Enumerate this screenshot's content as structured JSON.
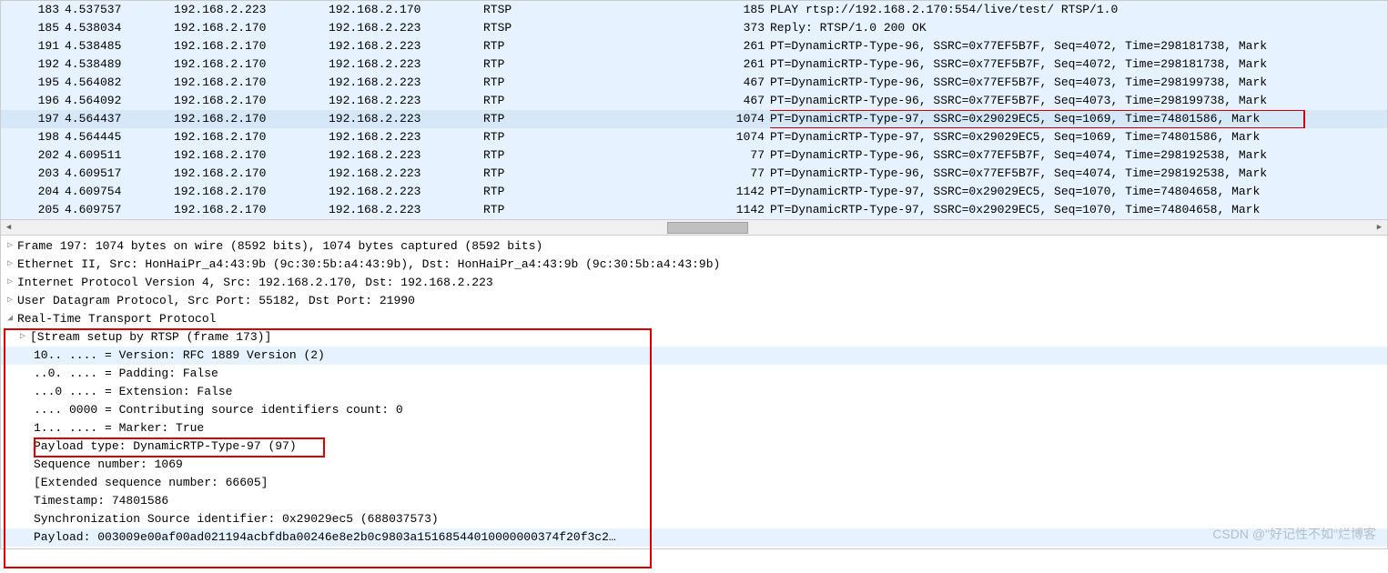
{
  "packets": [
    {
      "no": "183",
      "time": "4.537537",
      "src": "192.168.2.223",
      "dst": "192.168.2.170",
      "proto": "RTSP",
      "len": "185",
      "info": "PLAY rtsp://192.168.2.170:554/live/test/ RTSP/1.0",
      "hl": true
    },
    {
      "no": "185",
      "time": "4.538034",
      "src": "192.168.2.170",
      "dst": "192.168.2.223",
      "proto": "RTSP",
      "len": "373",
      "info": "Reply: RTSP/1.0 200 OK",
      "hl": true
    },
    {
      "no": "191",
      "time": "4.538485",
      "src": "192.168.2.170",
      "dst": "192.168.2.223",
      "proto": "RTP",
      "len": "261",
      "info": "PT=DynamicRTP-Type-96, SSRC=0x77EF5B7F, Seq=4072, Time=298181738, Mark",
      "hl": true
    },
    {
      "no": "192",
      "time": "4.538489",
      "src": "192.168.2.170",
      "dst": "192.168.2.223",
      "proto": "RTP",
      "len": "261",
      "info": "PT=DynamicRTP-Type-96, SSRC=0x77EF5B7F, Seq=4072, Time=298181738, Mark",
      "hl": true
    },
    {
      "no": "195",
      "time": "4.564082",
      "src": "192.168.2.170",
      "dst": "192.168.2.223",
      "proto": "RTP",
      "len": "467",
      "info": "PT=DynamicRTP-Type-96, SSRC=0x77EF5B7F, Seq=4073, Time=298199738, Mark",
      "hl": true
    },
    {
      "no": "196",
      "time": "4.564092",
      "src": "192.168.2.170",
      "dst": "192.168.2.223",
      "proto": "RTP",
      "len": "467",
      "info": "PT=DynamicRTP-Type-96, SSRC=0x77EF5B7F, Seq=4073, Time=298199738, Mark",
      "hl": true
    },
    {
      "no": "197",
      "time": "4.564437",
      "src": "192.168.2.170",
      "dst": "192.168.2.223",
      "proto": "RTP",
      "len": "1074",
      "info": "PT=DynamicRTP-Type-97, SSRC=0x29029EC5, Seq=1069, Time=74801586, Mark",
      "sel": true,
      "rb": true
    },
    {
      "no": "198",
      "time": "4.564445",
      "src": "192.168.2.170",
      "dst": "192.168.2.223",
      "proto": "RTP",
      "len": "1074",
      "info": "PT=DynamicRTP-Type-97, SSRC=0x29029EC5, Seq=1069, Time=74801586, Mark",
      "hl": true
    },
    {
      "no": "202",
      "time": "4.609511",
      "src": "192.168.2.170",
      "dst": "192.168.2.223",
      "proto": "RTP",
      "len": "77",
      "info": "PT=DynamicRTP-Type-96, SSRC=0x77EF5B7F, Seq=4074, Time=298192538, Mark",
      "hl": true
    },
    {
      "no": "203",
      "time": "4.609517",
      "src": "192.168.2.170",
      "dst": "192.168.2.223",
      "proto": "RTP",
      "len": "77",
      "info": "PT=DynamicRTP-Type-96, SSRC=0x77EF5B7F, Seq=4074, Time=298192538, Mark",
      "hl": true
    },
    {
      "no": "204",
      "time": "4.609754",
      "src": "192.168.2.170",
      "dst": "192.168.2.223",
      "proto": "RTP",
      "len": "1142",
      "info": "PT=DynamicRTP-Type-97, SSRC=0x29029EC5, Seq=1070, Time=74804658, Mark",
      "hl": true
    },
    {
      "no": "205",
      "time": "4.609757",
      "src": "192.168.2.170",
      "dst": "192.168.2.223",
      "proto": "RTP",
      "len": "1142",
      "info": "PT=DynamicRTP-Type-97, SSRC=0x29029EC5, Seq=1070, Time=74804658, Mark",
      "hl": true
    }
  ],
  "details": {
    "frame": "Frame 197: 1074 bytes on wire (8592 bits), 1074 bytes captured (8592 bits)",
    "eth": "Ethernet II, Src: HonHaiPr_a4:43:9b (9c:30:5b:a4:43:9b), Dst: HonHaiPr_a4:43:9b (9c:30:5b:a4:43:9b)",
    "ip": "Internet Protocol Version 4, Src: 192.168.2.170, Dst: 192.168.2.223",
    "udp": "User Datagram Protocol, Src Port: 55182, Dst Port: 21990",
    "rtp": "Real-Time Transport Protocol",
    "setup": "[Stream setup by RTSP (frame 173)]",
    "version": "10.. .... = Version: RFC 1889 Version (2)",
    "padding": "..0. .... = Padding: False",
    "ext": "...0 .... = Extension: False",
    "csrc": ".... 0000 = Contributing source identifiers count: 0",
    "marker": "1... .... = Marker: True",
    "pt": "Payload type: DynamicRTP-Type-97 (97)",
    "seq": "Sequence number: 1069",
    "extseq": "[Extended sequence number: 66605]",
    "ts": "Timestamp: 74801586",
    "ssrc": "Synchronization Source identifier: 0x29029ec5 (688037573)",
    "payload": "Payload: 003009e00af00ad021194acbfdba00246e8e2b0c9803a15168544010000000374f20f3c2…"
  },
  "watermark": "CSDN @\"好记性不如\"烂博客"
}
